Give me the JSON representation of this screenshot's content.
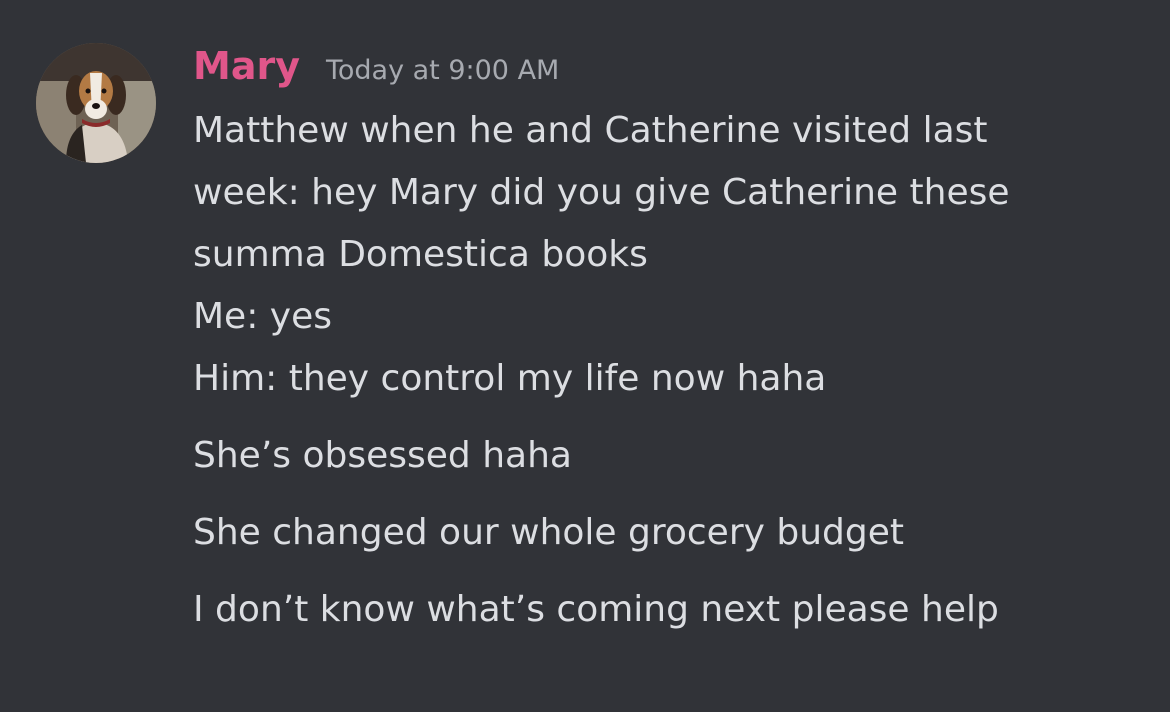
{
  "message": {
    "author": "Mary",
    "timestamp": "Today at 9:00 AM",
    "avatar_icon": "beagle-dog-avatar",
    "author_color": "#e0568a",
    "first_block": [
      "Matthew when he and Catherine visited last",
      "week: hey Mary did you give Catherine these",
      "summa Domestica books",
      "Me: yes",
      "Him: they control my life now haha"
    ],
    "followups": [
      "She’s obsessed haha",
      "She changed our whole grocery budget",
      "I don’t know what’s coming next please help"
    ]
  }
}
